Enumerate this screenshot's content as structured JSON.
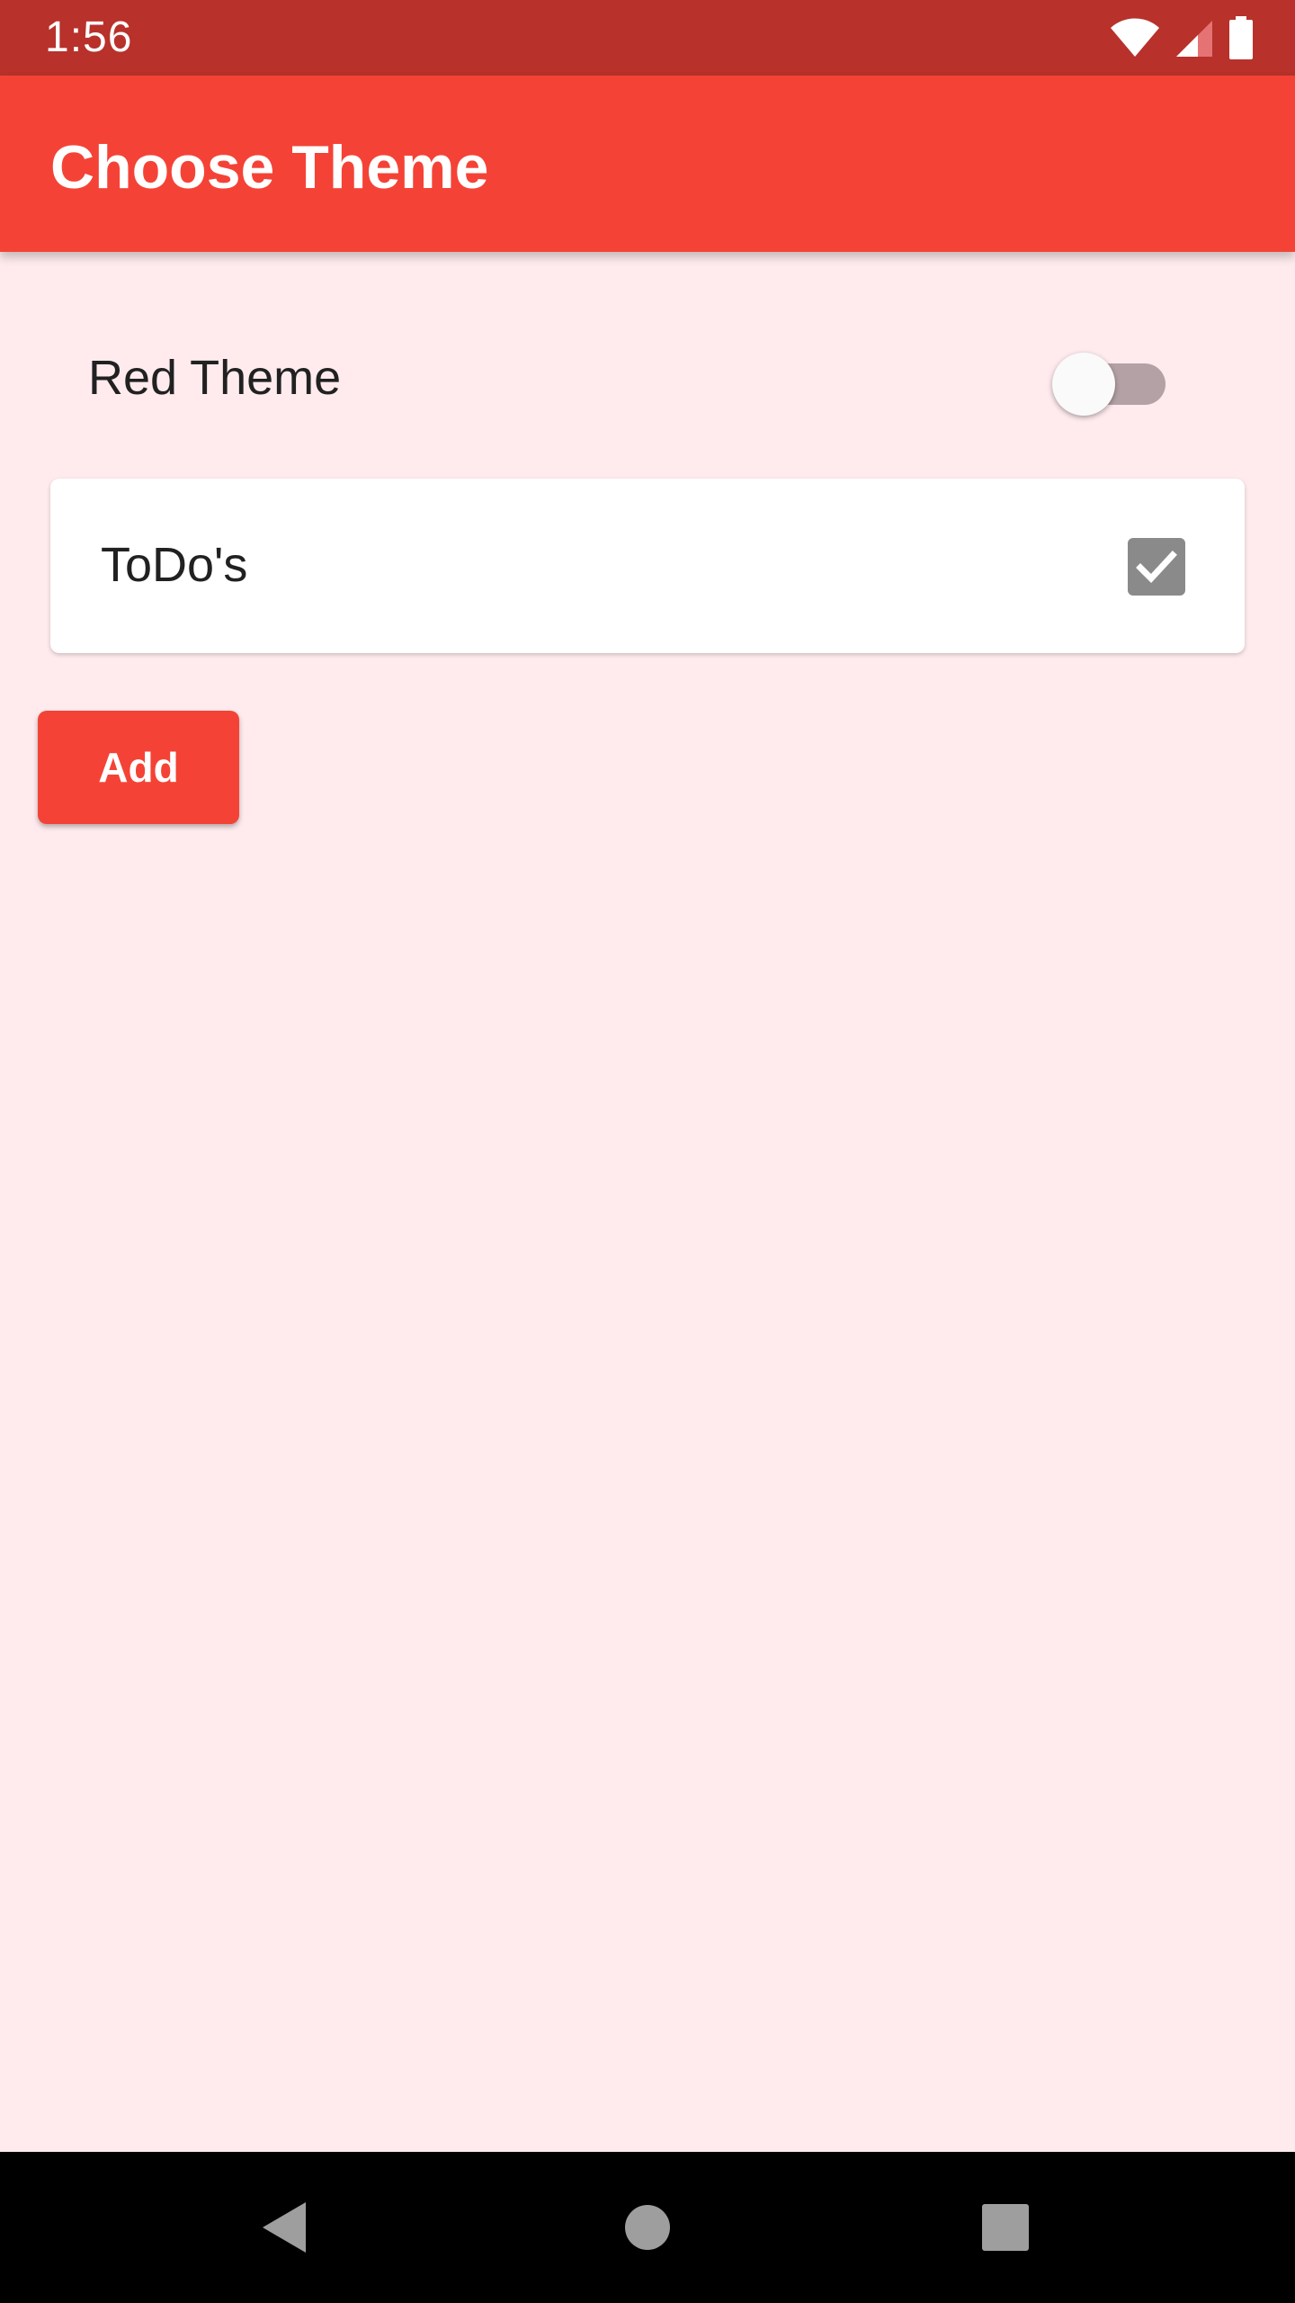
{
  "status_bar": {
    "time": "1:56",
    "icons": [
      "wifi-icon",
      "signal-icon",
      "battery-icon"
    ],
    "background": "#B8312B"
  },
  "app_bar": {
    "title": "Choose Theme",
    "background": "#F44336"
  },
  "theme_setting": {
    "label": "Red Theme",
    "enabled": false
  },
  "todo_card": {
    "label": "ToDo's",
    "checked": true
  },
  "add_button": {
    "label": "Add"
  },
  "nav_bar": {
    "buttons": [
      "back-icon",
      "home-icon",
      "recents-icon"
    ]
  },
  "colors": {
    "accent": "#F44336",
    "page_background": "#FFEBEE",
    "switch_track_off": "#B3A1A5",
    "checkbox_fill": "#8A8A8A"
  }
}
